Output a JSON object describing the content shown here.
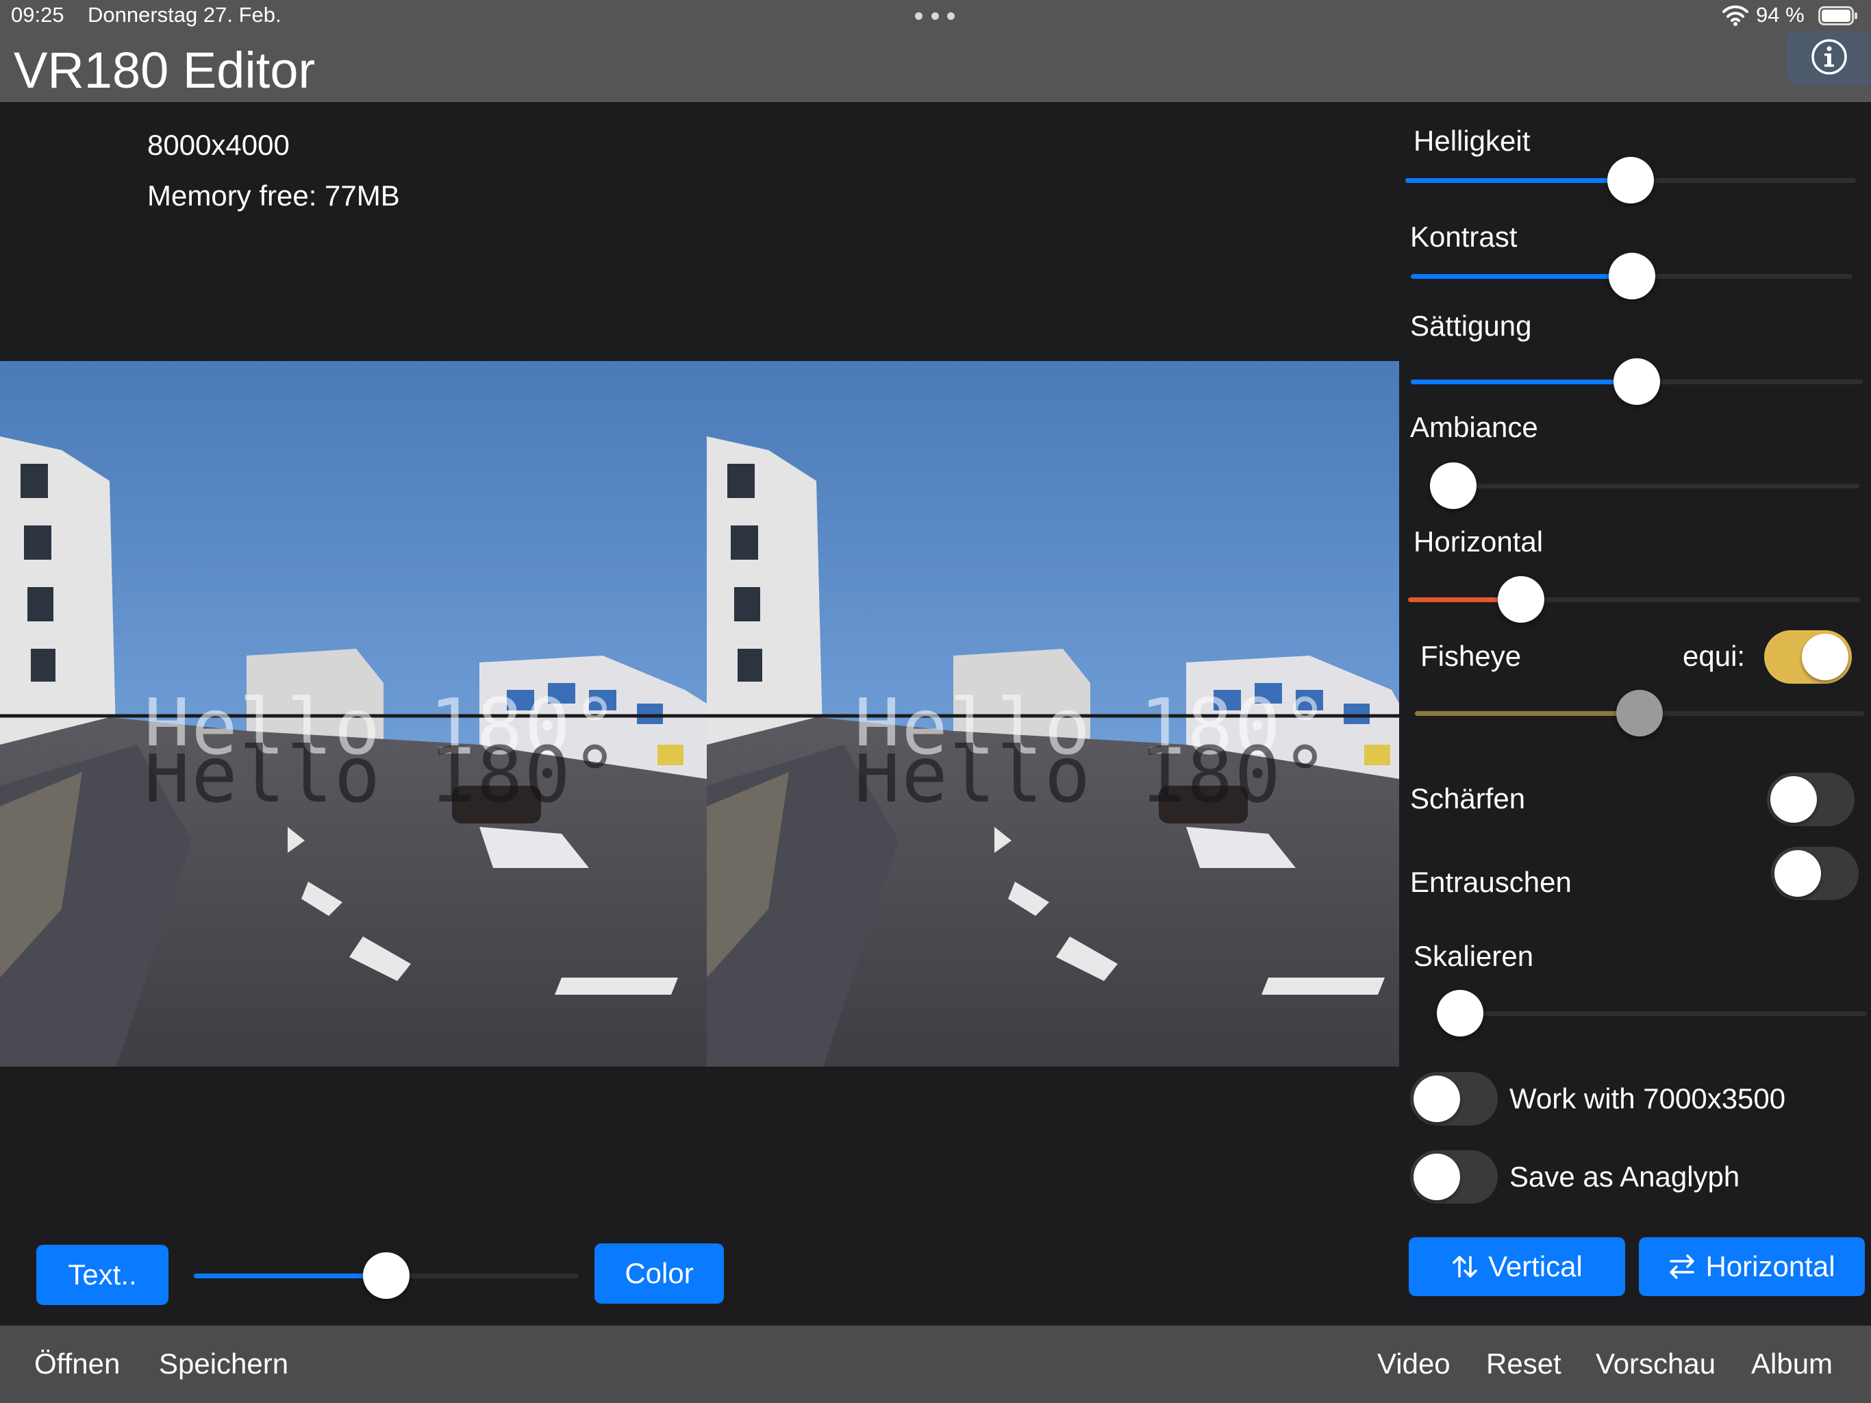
{
  "status": {
    "time": "09:25",
    "date": "Donnerstag 27. Feb.",
    "battery": "94 %"
  },
  "app": {
    "title": "VR180 Editor"
  },
  "info": {
    "resolution": "8000x4000",
    "memory": "Memory free: 77MB"
  },
  "preview": {
    "overlay_text": "Hello 180°"
  },
  "controls": {
    "helligkeit": {
      "label": "Helligkeit",
      "value": 0.5
    },
    "kontrast": {
      "label": "Kontrast",
      "value": 0.5
    },
    "saettigung": {
      "label": "Sättigung",
      "value": 0.5
    },
    "ambiance": {
      "label": "Ambiance",
      "value": 0.0
    },
    "horizontal": {
      "label": "Horizontal",
      "value": 0.25
    },
    "fisheye": {
      "label": "Fisheye",
      "value": 0.5,
      "equi_label": "equi:",
      "equi_on": true
    },
    "schaerfen": {
      "label": "Schärfen",
      "on": false
    },
    "entrauschen": {
      "label": "Entrauschen",
      "on": false
    },
    "skalieren": {
      "label": "Skalieren",
      "value": 0.0
    },
    "work_with": {
      "label": "Work with 7000x3500",
      "on": false
    },
    "save_anaglyph": {
      "label": "Save as Anaglyph",
      "on": false
    }
  },
  "flip_buttons": {
    "vertical": "Vertical",
    "horizontal": "Horizontal"
  },
  "text_controls": {
    "text_button": "Text..",
    "size_value": 0.5,
    "color_button": "Color"
  },
  "bottom_nav": {
    "left": [
      "Öffnen",
      "Speichern"
    ],
    "right": [
      "Video",
      "Reset",
      "Vorschau",
      "Album"
    ]
  },
  "colors": {
    "accent": "#0a7aff",
    "horizontal_fill": "#e35a2b",
    "fisheye_fill": "#8a7a3e",
    "toggle_on": "#e0b94e"
  },
  "icons": [
    "wifi-icon",
    "battery-icon",
    "info-icon",
    "vertical-flip-icon",
    "horizontal-flip-icon"
  ]
}
